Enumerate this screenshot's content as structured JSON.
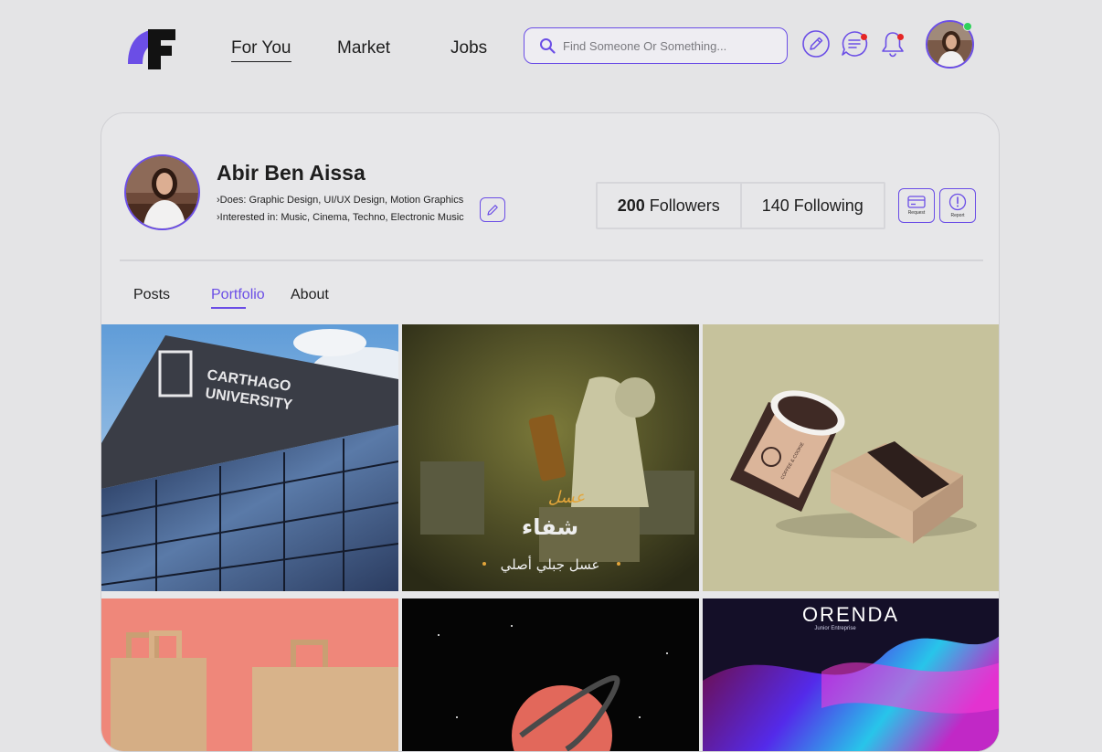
{
  "nav": {
    "items": [
      {
        "label": "For You",
        "active": true
      },
      {
        "label": "Market",
        "active": false
      },
      {
        "label": "Jobs",
        "active": false
      }
    ]
  },
  "search": {
    "placeholder": "Find Someone Or Something...",
    "value": ""
  },
  "colors": {
    "accent": "#6b4ee6",
    "notification": "#e52525",
    "online": "#2fd15b",
    "background": "#e4e4e6"
  },
  "icons": [
    "logo",
    "search-icon",
    "edit-pen-icon",
    "chat-icon",
    "bell-icon",
    "card-icon",
    "report-icon",
    "pencil-icon"
  ],
  "profile": {
    "name": "Abir Ben Aissa",
    "does": "Does: Graphic Design, UI/UX Design, Motion Graphics",
    "interests": "Interested in: Music, Cinema, Techno, Electronic Music",
    "followers_count": "200",
    "followers_label": "Followers",
    "following_count": "140",
    "following_label": "Following",
    "request_label": "Request",
    "report_label": "Report"
  },
  "tabs": [
    {
      "label": "Posts",
      "active": false
    },
    {
      "label": "Portfolio",
      "active": true
    },
    {
      "label": "About",
      "active": false
    }
  ],
  "portfolio": {
    "tiles": [
      {
        "title_line1": "CARTHAGO",
        "title_line2": "UNIVERSITY"
      },
      {
        "arabic_script": "عسل",
        "arabic_title": "شفاء",
        "arabic_caption": "عسل جبلي أصلي"
      },
      {
        "brand": "COFFEE & COOKIE"
      },
      {},
      {},
      {
        "brand": "ORENDA",
        "subtitle": "Junior Entreprise"
      }
    ]
  }
}
